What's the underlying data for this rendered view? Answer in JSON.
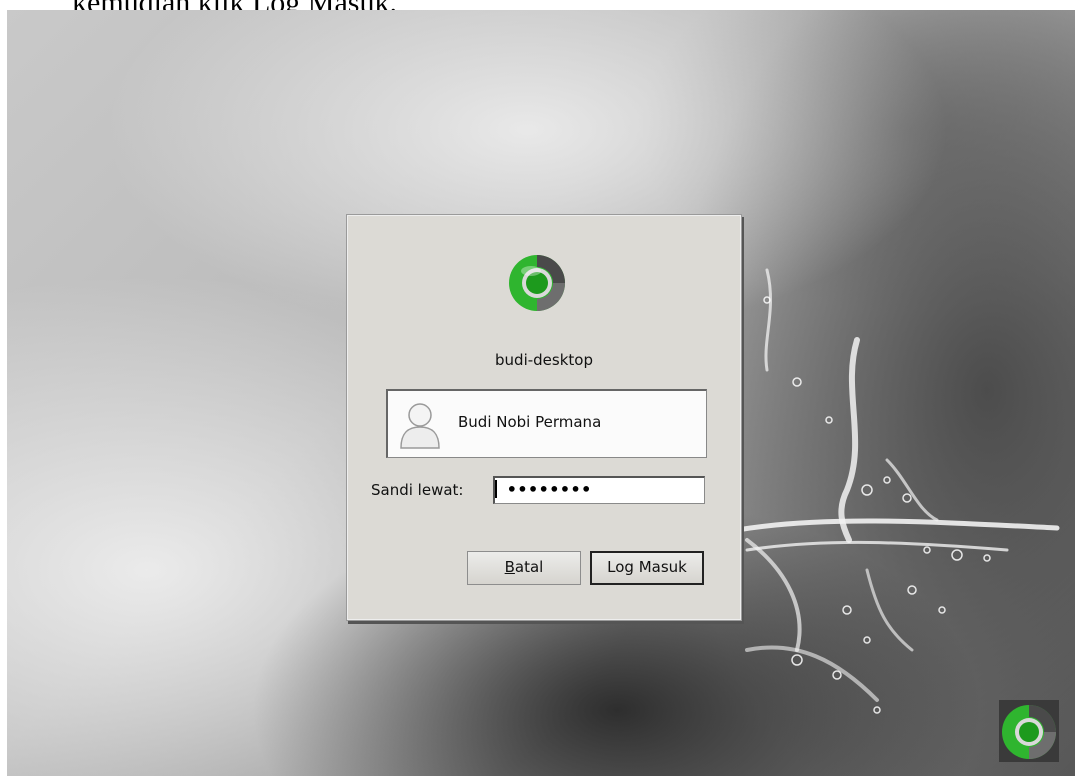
{
  "document": {
    "caption": "kemudian klik Log Masuk."
  },
  "login_dialog": {
    "logo_icon": "distro-logo-icon",
    "hostname": "budi-desktop",
    "user": {
      "avatar_icon": "user-avatar-icon",
      "name": "Budi Nobi Permana"
    },
    "password": {
      "label": "Sandi lewat:",
      "value_masked": "••••••••"
    },
    "buttons": {
      "cancel_mnemonic": "B",
      "cancel_rest": "atal",
      "login_label": "Log Masuk"
    }
  },
  "desktop": {
    "corner_logo_icon": "distro-logo-icon"
  },
  "colors": {
    "logo_green": "#2fb52f",
    "dialog_bg": "#dcdad5"
  }
}
